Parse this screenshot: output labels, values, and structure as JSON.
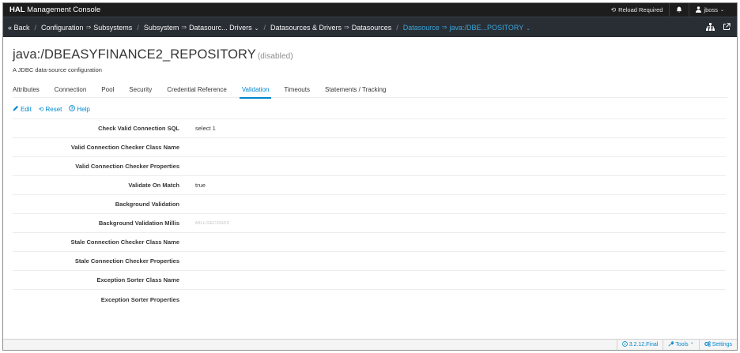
{
  "app": {
    "brand_bold": "HAL",
    "brand_rest": " Management Console"
  },
  "topbar": {
    "reload_label": "Reload Required",
    "user_label": "jboss"
  },
  "breadcrumb": {
    "back": "« Back",
    "items": [
      "Configuration",
      "Subsystems",
      "Subsystem",
      "Datasourc... Drivers",
      "Datasources & Drivers",
      "Datasources",
      "Datasource",
      "java:/DBE...POSITORY"
    ]
  },
  "page": {
    "title": "java:/DBEASYFINANCE2_REPOSITORY",
    "state": "(disabled)",
    "subtitle": "A JDBC data-source configuration"
  },
  "tabs": [
    "Attributes",
    "Connection",
    "Pool",
    "Security",
    "Credential Reference",
    "Validation",
    "Timeouts",
    "Statements / Tracking"
  ],
  "active_tab": "Validation",
  "actions": {
    "edit": "Edit",
    "reset": "Reset",
    "help": "Help"
  },
  "attributes": [
    {
      "label": "Check Valid Connection SQL",
      "value": "select 1"
    },
    {
      "label": "Valid Connection Checker Class Name",
      "value": ""
    },
    {
      "label": "Valid Connection Checker Properties",
      "value": ""
    },
    {
      "label": "Validate On Match",
      "value": "true"
    },
    {
      "label": "Background Validation",
      "value": ""
    },
    {
      "label": "Background Validation Millis",
      "value": "MILLISECONDS"
    },
    {
      "label": "Stale Connection Checker Class Name",
      "value": ""
    },
    {
      "label": "Stale Connection Checker Properties",
      "value": ""
    },
    {
      "label": "Exception Sorter Class Name",
      "value": ""
    },
    {
      "label": "Exception Sorter Properties",
      "value": ""
    }
  ],
  "footer": {
    "version": "3.2.12.Final",
    "tools": "Tools",
    "settings": "Settings"
  },
  "colors": {
    "accent": "#0088ce",
    "topbar": "#1d1d1d",
    "navbar": "#292e34",
    "active_crumb": "#39a5dc"
  }
}
